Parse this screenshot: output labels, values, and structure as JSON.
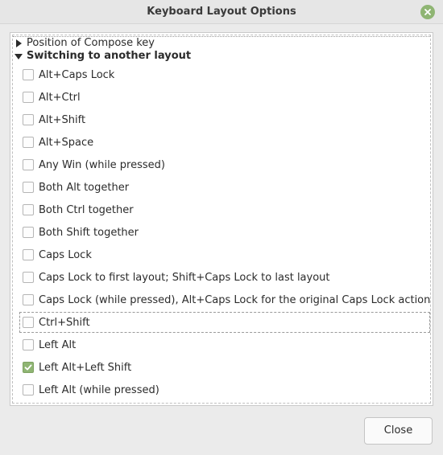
{
  "window": {
    "title": "Keyboard Layout Options"
  },
  "tree": {
    "groups": [
      {
        "label": "Position of Compose key",
        "expanded": false
      },
      {
        "label": "Switching to another layout",
        "expanded": true
      }
    ],
    "options": [
      {
        "label": "Alt+Caps Lock",
        "checked": false
      },
      {
        "label": "Alt+Ctrl",
        "checked": false
      },
      {
        "label": "Alt+Shift",
        "checked": false
      },
      {
        "label": "Alt+Space",
        "checked": false
      },
      {
        "label": "Any Win (while pressed)",
        "checked": false
      },
      {
        "label": "Both Alt together",
        "checked": false
      },
      {
        "label": "Both Ctrl together",
        "checked": false
      },
      {
        "label": "Both Shift together",
        "checked": false
      },
      {
        "label": "Caps Lock",
        "checked": false
      },
      {
        "label": "Caps Lock to first layout; Shift+Caps Lock to last layout",
        "checked": false
      },
      {
        "label": "Caps Lock (while pressed), Alt+Caps Lock for the original Caps Lock action",
        "checked": false
      },
      {
        "label": "Ctrl+Shift",
        "checked": false,
        "focused": true
      },
      {
        "label": "Left Alt",
        "checked": false
      },
      {
        "label": "Left Alt+Left Shift",
        "checked": true
      },
      {
        "label": "Left Alt (while pressed)",
        "checked": false
      }
    ]
  },
  "footer": {
    "close_label": "Close"
  },
  "colors": {
    "accent": "#8fb573"
  }
}
